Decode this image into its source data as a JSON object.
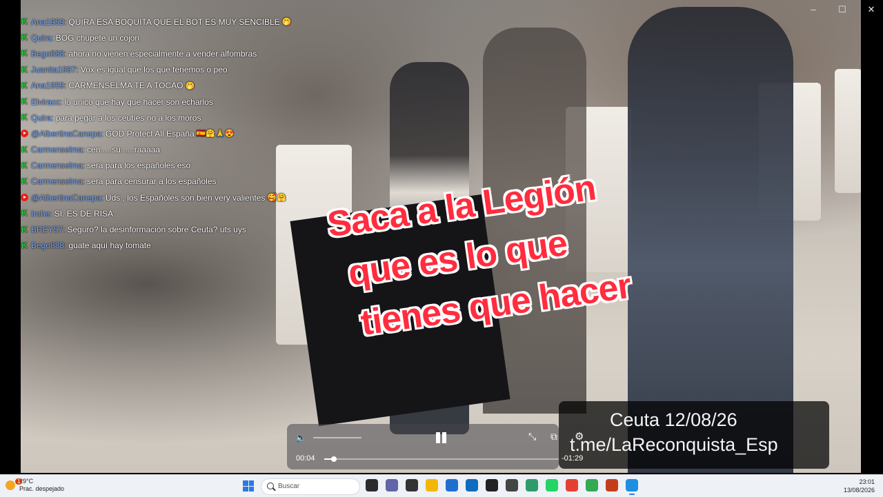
{
  "window": {
    "minimize_icon": "minimize-icon",
    "maximize_icon": "maximize-icon",
    "close_icon": "close-icon"
  },
  "chat": [
    {
      "platform": "kick",
      "user": "Ana1959",
      "text": "QUIRA ESA BOQUITA QUE EL BOT ES MUY SENCIBLE",
      "emoji": "🤭"
    },
    {
      "platform": "kick",
      "user": "Quira",
      "text": "BOG chupete un cojon",
      "emoji": ""
    },
    {
      "platform": "kick",
      "user": "Bego888",
      "text": "ahora no vienen especialmente a vender alfombras",
      "emoji": ""
    },
    {
      "platform": "kick",
      "user": "Juanita1987",
      "text": "Vox es igual que los que tenemos o peo",
      "emoji": ""
    },
    {
      "platform": "kick",
      "user": "Ana1959",
      "text": "CARMENSELMA TE A TOCAO",
      "emoji": "🤭"
    },
    {
      "platform": "kick",
      "user": "Elviracc",
      "text": "lo unico que hay que hacer son echarlos",
      "emoji": ""
    },
    {
      "platform": "kick",
      "user": "Quira",
      "text": "para pegar a los ceutíes no a los moros",
      "emoji": ""
    },
    {
      "platform": "youtube",
      "user": "@AlbertinaCanepa",
      "text": "GOD Protect All España",
      "emoji": "🇪🇸🤗🙏😍"
    },
    {
      "platform": "kick",
      "user": "Carmenselma",
      "text": "cen.....su......raaaaa",
      "emoji": ""
    },
    {
      "platform": "kick",
      "user": "Carmenselma",
      "text": "será para los españoles eso",
      "emoji": ""
    },
    {
      "platform": "kick",
      "user": "Carmenselma",
      "text": "será para censurar a los españoles",
      "emoji": ""
    },
    {
      "platform": "youtube",
      "user": "@AlbertinaCanepa",
      "text": "Uds , los Españoles son bien very valientes",
      "emoji": "🥰🤗"
    },
    {
      "platform": "kick",
      "user": "Irohe",
      "text": "SI. ES DE RISA.",
      "emoji": ""
    },
    {
      "platform": "kick",
      "user": "BREY57",
      "text": "Seguro? la desinformación sobre Ceuta? uts uys",
      "emoji": ""
    },
    {
      "platform": "kick",
      "user": "Bego888",
      "text": "guate aquí hay tomate",
      "emoji": ""
    }
  ],
  "caption": {
    "line1": "Saca a la Legión",
    "line2": "que es lo que",
    "line3": "tienes que hacer"
  },
  "watermark": {
    "line1": "Ceuta 12/08/26",
    "line2": "t.me/LaReconquista_Esp"
  },
  "player": {
    "current_time": "00:04",
    "remaining_time": "-01:29",
    "progress": 0.04,
    "volume_icon": "volume-icon",
    "pause_icon": "pause-icon",
    "collapse_icon": "collapse-icon",
    "pip_icon": "pip-icon",
    "settings_icon": "gear-icon"
  },
  "taskbar": {
    "weather_temp": "29°C",
    "weather_desc": "Prac. despejado",
    "weather_badge": "1",
    "search_placeholder": "Buscar",
    "time": "23:01",
    "date": "13/08/2026",
    "apps": [
      {
        "name": "terminal-app-icon",
        "color": "#2b2b2b"
      },
      {
        "name": "teams-app-icon",
        "color": "#6264a7"
      },
      {
        "name": "inkscape-app-icon",
        "color": "#333333"
      },
      {
        "name": "file-explorer-app-icon",
        "color": "#f2b705"
      },
      {
        "name": "store-app-icon",
        "color": "#1f6fd1"
      },
      {
        "name": "outlook-app-icon",
        "color": "#0f6cbd"
      },
      {
        "name": "obs-app-icon",
        "color": "#222222"
      },
      {
        "name": "unity-app-icon",
        "color": "#444444"
      },
      {
        "name": "browser-app-icon",
        "color": "#2e9c6a"
      },
      {
        "name": "whatsapp-app-icon",
        "color": "#25d366"
      },
      {
        "name": "chrome-app-icon",
        "color": "#e44134"
      },
      {
        "name": "chrome-profile-app-icon",
        "color": "#34a853"
      },
      {
        "name": "powerpoint-app-icon",
        "color": "#c43e1c"
      },
      {
        "name": "streaming-app-icon",
        "color": "#1d8fe1"
      }
    ]
  }
}
